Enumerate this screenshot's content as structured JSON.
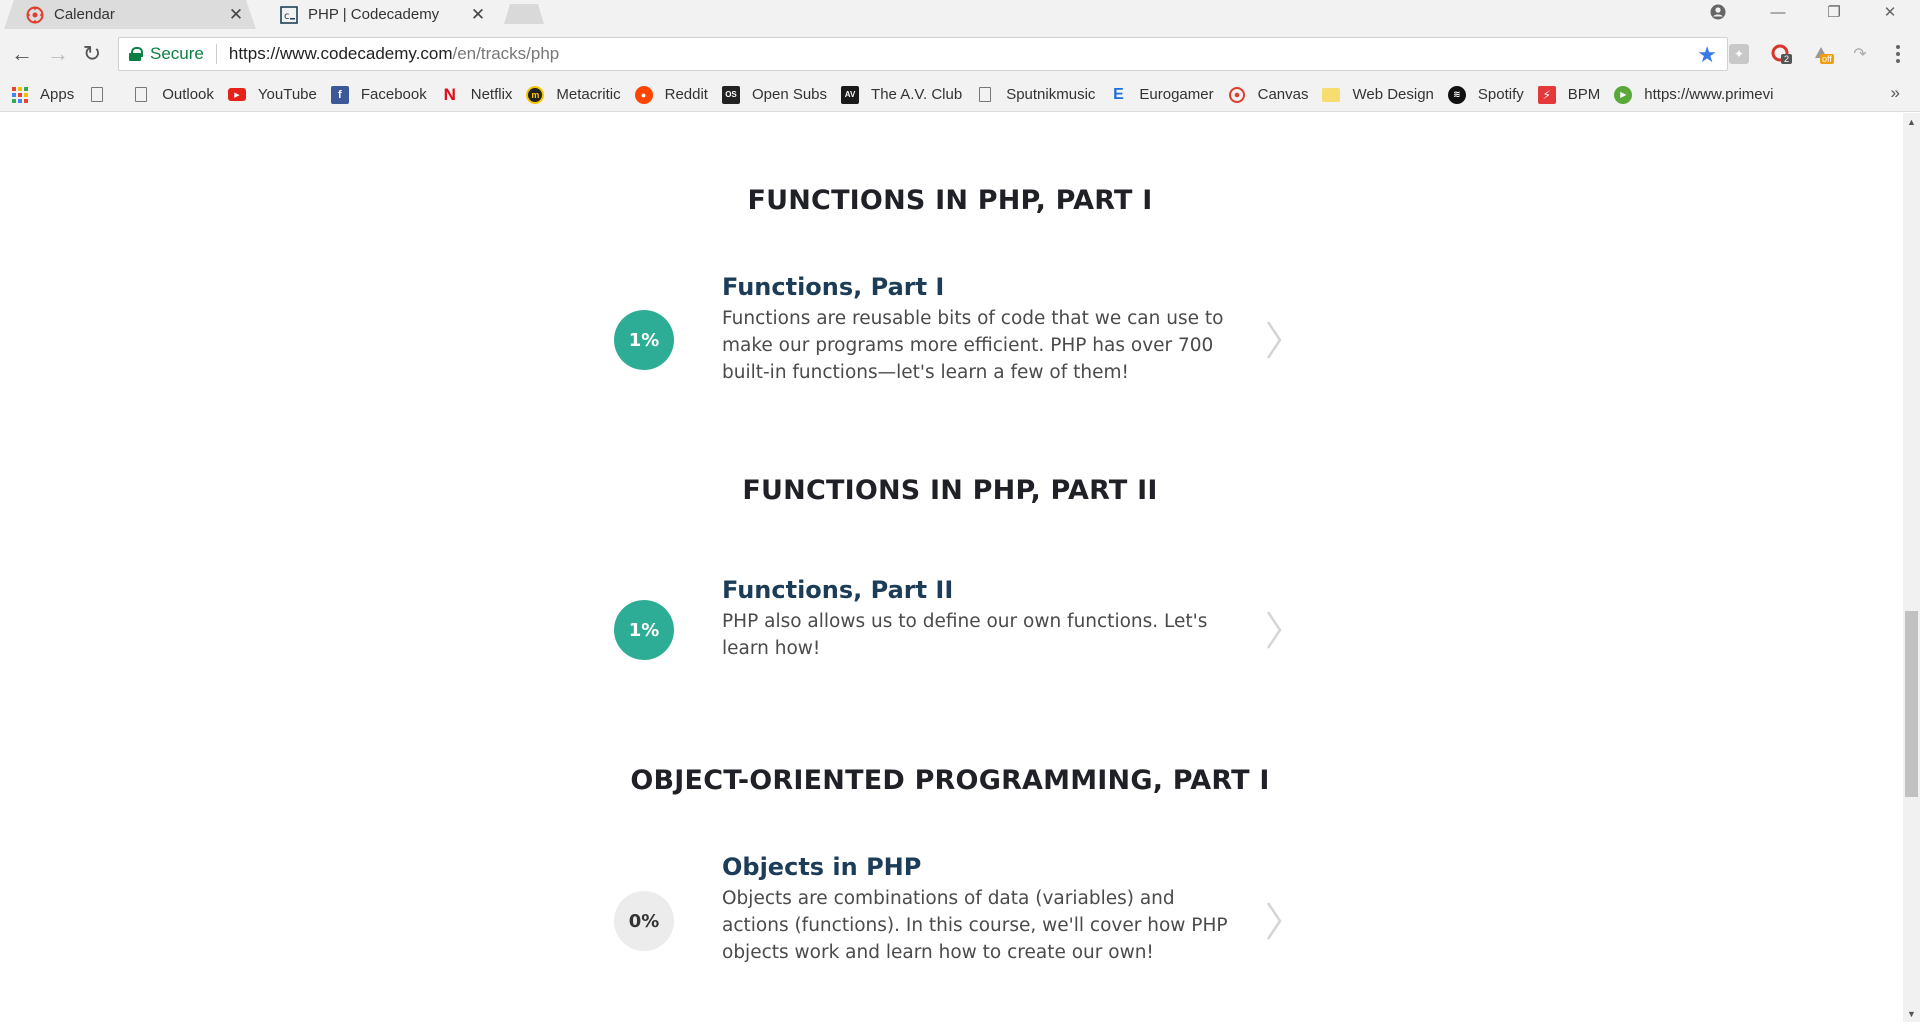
{
  "browser": {
    "tabs": [
      {
        "title": "Calendar",
        "active": false,
        "icon": "canvas-icon"
      },
      {
        "title": "PHP | Codecademy",
        "active": true,
        "icon": "codecademy-icon"
      }
    ],
    "tab_close_glyph": "✕",
    "window_controls": {
      "minimize": "—",
      "restore": "❐",
      "close": "✕"
    },
    "nav": {
      "back": "←",
      "forward": "→",
      "reload": "↻"
    },
    "address": {
      "secure_label": "Secure",
      "url_host": "https://www.codecademy.com",
      "url_path": "/en/tracks/php"
    },
    "star_glyph": "★",
    "extensions": [
      {
        "name": "extension-1-icon",
        "badge": ""
      },
      {
        "name": "extension-2-icon",
        "badge": "2"
      },
      {
        "name": "extension-3-icon",
        "badge": "off"
      },
      {
        "name": "extension-4-icon",
        "badge": ""
      }
    ],
    "bookmarks": [
      {
        "label": "Apps",
        "icon": "apps-grid-icon"
      },
      {
        "label": "",
        "icon": "page-icon"
      },
      {
        "label": "Outlook",
        "icon": "page-icon"
      },
      {
        "label": "YouTube",
        "icon": "youtube-icon"
      },
      {
        "label": "Facebook",
        "icon": "facebook-icon"
      },
      {
        "label": "Netflix",
        "icon": "netflix-icon"
      },
      {
        "label": "Metacritic",
        "icon": "metacritic-icon"
      },
      {
        "label": "Reddit",
        "icon": "reddit-icon"
      },
      {
        "label": "Open Subs",
        "icon": "opensubtitles-icon"
      },
      {
        "label": "The A.V. Club",
        "icon": "avclub-icon"
      },
      {
        "label": "Sputnikmusic",
        "icon": "page-icon"
      },
      {
        "label": "Eurogamer",
        "icon": "eurogamer-icon"
      },
      {
        "label": "Canvas",
        "icon": "canvas-icon"
      },
      {
        "label": "Web Design",
        "icon": "folder-icon"
      },
      {
        "label": "Spotify",
        "icon": "spotify-icon"
      },
      {
        "label": "BPM",
        "icon": "bpm-icon"
      },
      {
        "label": "https://www.primevi",
        "icon": "play-icon"
      }
    ],
    "bookmarks_more": "»"
  },
  "sections": [
    {
      "title": "FUNCTIONS IN PHP, PART I",
      "course": {
        "progress": "1%",
        "name": "Functions, Part I",
        "description": "Functions are reusable bits of code that we can use to make our programs more efficient. PHP has over 700 built-in functions—let's learn a few of them!"
      }
    },
    {
      "title": "FUNCTIONS IN PHP, PART II",
      "course": {
        "progress": "1%",
        "name": "Functions, Part II",
        "description": "PHP also allows us to define our own functions. Let's learn how!"
      }
    },
    {
      "title": "OBJECT-ORIENTED PROGRAMMING, PART I",
      "course": {
        "progress": "0%",
        "name": "Objects in PHP",
        "description": "Objects are combinations of data (variables) and actions (functions). In this course, we'll cover how PHP objects work and learn how to create our own!"
      }
    }
  ],
  "colors": {
    "progress_started": "#2dad96",
    "progress_not_started": "#ececec",
    "course_title": "#1c3c58",
    "secure_green": "#0b8043",
    "bookmark_star": "#3b78e7"
  }
}
